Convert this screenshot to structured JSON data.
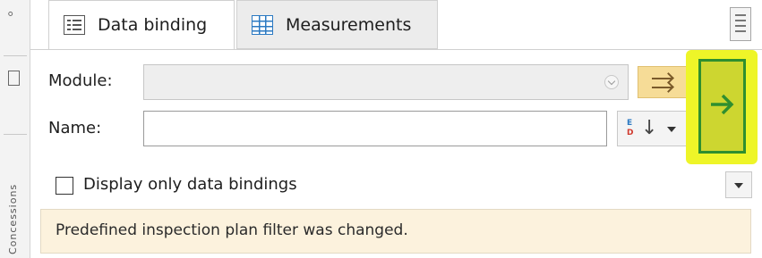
{
  "side_strip": {
    "vertical_text": "Concessions"
  },
  "tabs": [
    {
      "label": "Data binding",
      "icon": "data-binding-icon",
      "selected": true
    },
    {
      "label": "Measurements",
      "icon": "table-icon",
      "selected": false
    }
  ],
  "form": {
    "module_label": "Module:",
    "module_value": "",
    "name_label": "Name:",
    "name_value": "",
    "apply_icon": "arrow-right-into-icon",
    "sort_icon": "sort-columns-icon",
    "go_icon": "arrow-right-icon"
  },
  "filter": {
    "checkbox_label": "Display only data bindings",
    "checked": false
  },
  "info": {
    "message": "Predefined inspection plan filter was changed."
  },
  "colors": {
    "highlight": "#eef528",
    "go_button_border": "#2f8f2f",
    "go_arrow": "#2f8f2f",
    "apply_button": "#f6dc97",
    "info_background": "#fcf2dd",
    "table_icon": "#2b79c2"
  }
}
